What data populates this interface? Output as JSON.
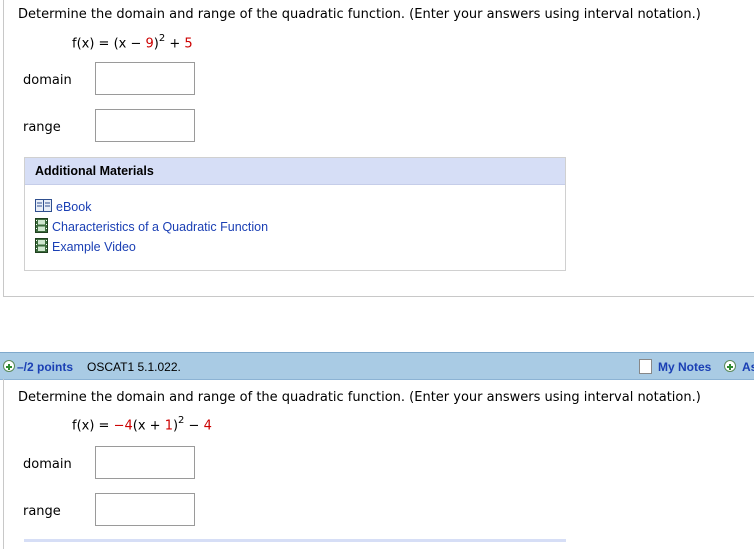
{
  "question1": {
    "prompt": "Determine the domain and range of the quadratic function. (Enter your answers using interval notation.)",
    "formula": {
      "lhs": "f(x) = (x − ",
      "h": "9",
      "close": ")",
      "exp": "2",
      "op": " + ",
      "k": "5"
    },
    "domain_label": "domain",
    "range_label": "range",
    "domain_value": "",
    "range_value": ""
  },
  "additional_materials": {
    "title": "Additional Materials",
    "items": [
      {
        "label": "eBook",
        "icon": "book-icon"
      },
      {
        "label": "Characteristics of a Quadratic Function",
        "icon": "film-icon"
      },
      {
        "label": "Example Video",
        "icon": "film-icon"
      }
    ]
  },
  "question2": {
    "points": "–/2 points",
    "code": "OSCAT1 5.1.022.",
    "my_notes": "My Notes",
    "ask": "As",
    "prompt": "Determine the domain and range of the quadratic function. (Enter your answers using interval notation.)",
    "formula": {
      "lhs": "f(x) = ",
      "a": "−4",
      "mid": "(x + ",
      "h": "1",
      "close": ")",
      "exp": "2",
      "op": " − ",
      "k": "4"
    },
    "domain_label": "domain",
    "range_label": "range",
    "domain_value": "",
    "range_value": ""
  },
  "colors": {
    "link": "#1a3fb4",
    "materials_header_bg": "#d6def6",
    "question_header_bg": "#a9cbe4",
    "highlight_red": "#cc0000"
  }
}
